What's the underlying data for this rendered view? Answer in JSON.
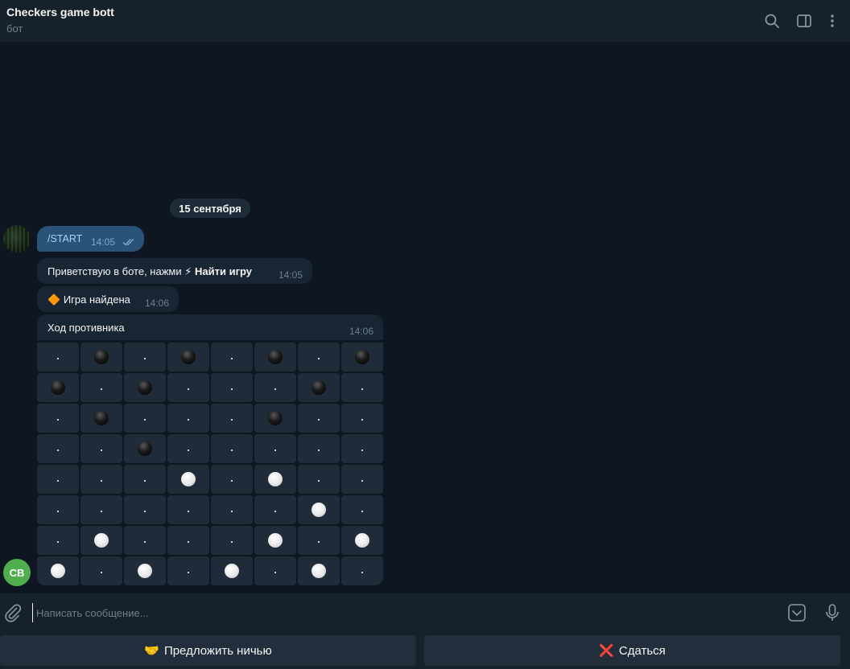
{
  "header": {
    "title": "Checkers game bott",
    "subtitle": "бот",
    "icons": [
      "search-icon",
      "sidebar-toggle-icon",
      "more-vertical-icon"
    ]
  },
  "chat": {
    "date": "15 сентября",
    "outgoing": {
      "text": "/START",
      "time": "14:05"
    },
    "messages": [
      {
        "prefix": "Приветствую в боте, нажми",
        "emoji": "⚡",
        "bold": "Найти игру",
        "time": "14:05"
      },
      {
        "emoji": "🔶",
        "text": "Игра найдена",
        "time": "14:06"
      },
      {
        "text": "Ход противника",
        "time": "14:06"
      }
    ],
    "bot_avatar_initials": "CB"
  },
  "board": {
    "cell_empty_label": ".",
    "rows": [
      [
        ".",
        "b",
        ".",
        "b",
        ".",
        "b",
        ".",
        "b"
      ],
      [
        "b",
        ".",
        "b",
        ".",
        ".",
        ".",
        "b",
        "."
      ],
      [
        ".",
        "b",
        ".",
        ".",
        ".",
        "b",
        ".",
        "."
      ],
      [
        ".",
        ".",
        "b",
        ".",
        ".",
        ".",
        ".",
        "."
      ],
      [
        ".",
        ".",
        ".",
        "w",
        ".",
        "w",
        ".",
        "."
      ],
      [
        ".",
        ".",
        ".",
        ".",
        ".",
        ".",
        "w",
        "."
      ],
      [
        ".",
        "w",
        ".",
        ".",
        ".",
        "w",
        ".",
        "w"
      ],
      [
        "w",
        ".",
        "w",
        ".",
        "w",
        ".",
        "w",
        "."
      ]
    ]
  },
  "input": {
    "placeholder": "Написать сообщение..."
  },
  "keyboard": {
    "draw": {
      "emoji": "🤝",
      "label": "Предложить ничью"
    },
    "surrender": {
      "emoji": "❌",
      "label": "Сдаться"
    }
  },
  "colors": {
    "background": "#0e1621",
    "panel": "#17212b",
    "bubble_in": "#182533",
    "bubble_out": "#2b5278",
    "cell": "#1f2b38",
    "accent": "#6ab3f3",
    "bot_avatar": "#4fae4e"
  }
}
